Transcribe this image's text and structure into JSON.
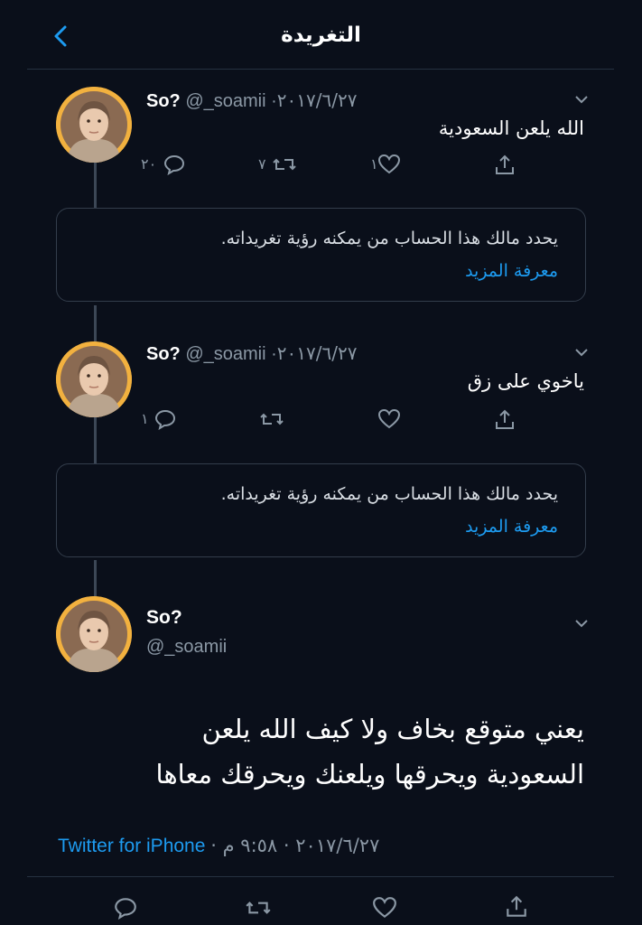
{
  "header": {
    "title": "التغريدة"
  },
  "tweets": [
    {
      "name": "So?",
      "handle": "@_soamii",
      "date": "٢٠١٧/٦/٢٧",
      "text": "الله يلعن السعودية",
      "replies": "٢٠",
      "retweets": "٧",
      "likes": "١"
    },
    {
      "name": "So?",
      "handle": "@_soamii",
      "date": "٢٠١٧/٦/٢٧",
      "text": "ياخوي على زق",
      "replies": "١"
    }
  ],
  "notice": {
    "text": "يحدد مالك هذا الحساب من يمكنه رؤية تغريداته.",
    "link": "معرفة المزيد"
  },
  "main_tweet": {
    "name": "So?",
    "handle": "@_soamii",
    "line1": "يعني متوقع بخاف ولا كيف الله يلعن",
    "line2": "السعودية ويحرقها ويلعنك ويحرقك معاها",
    "source": "Twitter for iPhone",
    "datetime": "٢٠١٧/٦/٢٧ · ٩:٥٨ م"
  },
  "colors": {
    "background": "#0a0f1a",
    "accent": "#1d9bf0",
    "muted": "#8b98a5",
    "avatar_bg": "#f2b13f"
  }
}
